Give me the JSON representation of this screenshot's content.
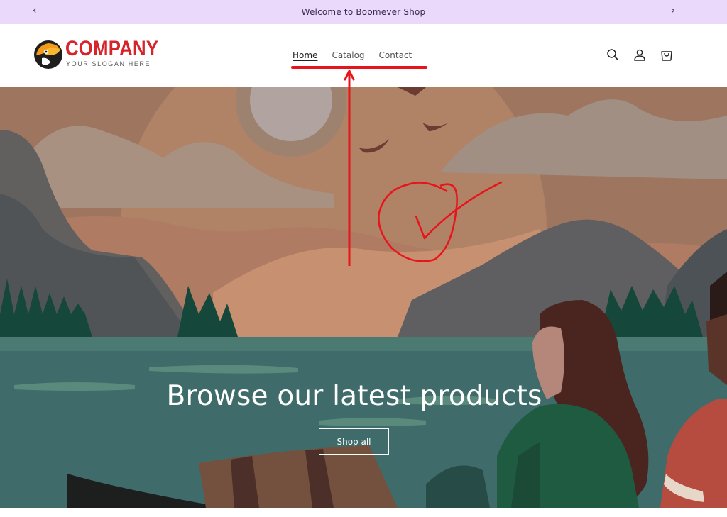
{
  "announcement": {
    "text": "Welcome to Boomever Shop",
    "prev_icon": "chevron-left-icon",
    "next_icon": "chevron-right-icon"
  },
  "logo": {
    "name": "COMPANY",
    "slogan": "YOUR SLOGAN HERE"
  },
  "nav": {
    "items": [
      {
        "label": "Home",
        "active": true
      },
      {
        "label": "Catalog",
        "active": false
      },
      {
        "label": "Contact",
        "active": false
      }
    ]
  },
  "header_icons": [
    "search-icon",
    "account-icon",
    "cart-icon"
  ],
  "hero": {
    "title": "Browse our latest products",
    "button_label": "Shop all"
  },
  "colors": {
    "announcement_bg": "#ead9fb",
    "logo_red": "#d5252b",
    "annotation_red": "#e8141b"
  }
}
